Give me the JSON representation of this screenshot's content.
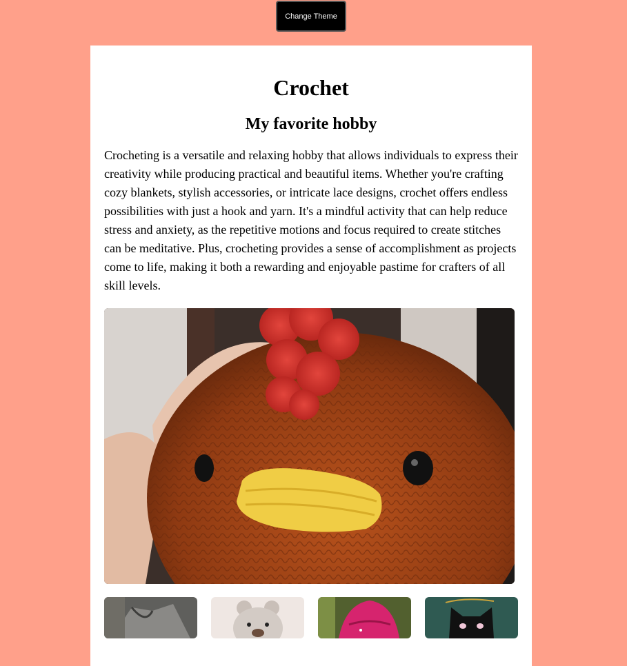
{
  "header": {
    "change_theme_label": "Change Theme"
  },
  "main": {
    "title": "Crochet",
    "subtitle": "My favorite hobby",
    "description": "Crocheting is a versatile and relaxing hobby that allows individuals to express their creativity while producing practical and beautiful items. Whether you're crafting cozy blankets, stylish accessories, or intricate lace designs, crochet offers endless possibilities with just a hook and yarn. It's a mindful activity that can help reduce stress and anxiety, as the repetitive motions and focus required to create stitches can be meditative. Plus, crocheting provides a sense of accomplishment as projects come to life, making it both a rewarding and enjoyable pastime for crafters of all skill levels."
  },
  "colors": {
    "page_background": "#ffa08a",
    "card_background": "#ffffff",
    "button_background": "#000000",
    "button_text": "#ffffff"
  }
}
